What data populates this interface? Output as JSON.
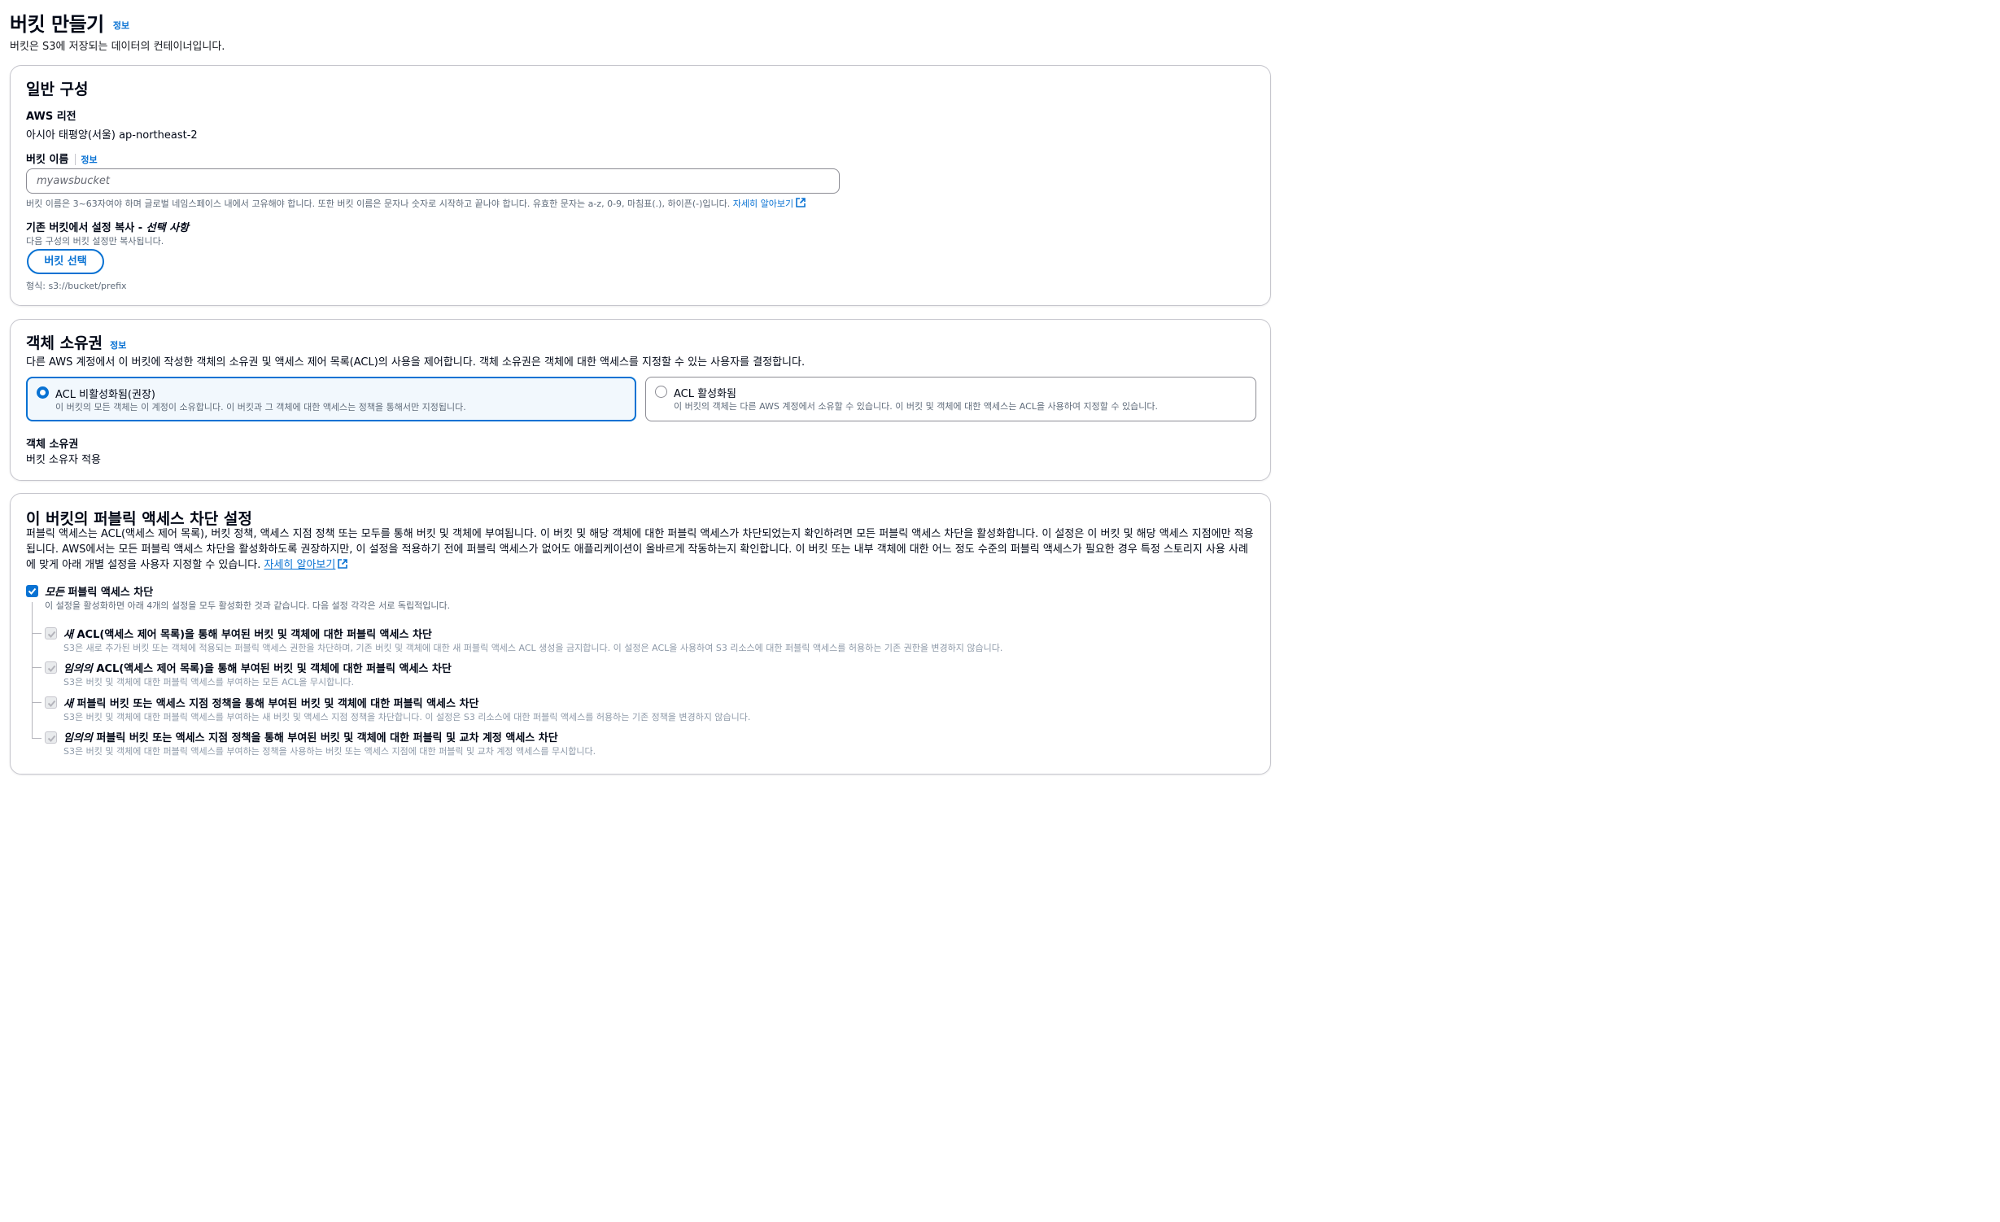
{
  "header": {
    "title": "버킷 만들기",
    "info": "정보",
    "description": "버킷은 S3에 저장되는 데이터의 컨테이너입니다."
  },
  "general": {
    "title": "일반 구성",
    "region_label": "AWS 리전",
    "region_value": "아시아 태평양(서울) ap-northeast-2",
    "bucket_name_label": "버킷 이름",
    "bucket_name_info": "정보",
    "bucket_name_placeholder": "myawsbucket",
    "bucket_name_hint": "버킷 이름은 3~63자여야 하며 글로벌 네임스페이스 내에서 고유해야 합니다. 또한 버킷 이름은 문자나 숫자로 시작하고 끝나야 합니다. 유효한 문자는 a-z, 0-9, 마침표(.), 하이픈(-)입니다.",
    "learn_more": "자세히 알아보기",
    "copy_label": "기존 버킷에서 설정 복사 - ",
    "copy_label_optional": "선택 사항",
    "copy_desc": "다음 구성의 버킷 설정만 복사됩니다.",
    "choose_bucket_button": "버킷 선택",
    "format_hint": "형식: s3://bucket/prefix"
  },
  "ownership": {
    "title": "객체 소유권",
    "info": "정보",
    "description": "다른 AWS 계정에서 이 버킷에 작성한 객체의 소유권 및 액세스 제어 목록(ACL)의 사용을 제어합니다. 객체 소유권은 객체에 대한 액세스를 지정할 수 있는 사용자를 결정합니다.",
    "options": [
      {
        "label": "ACL 비활성화됨(권장)",
        "desc": "이 버킷의 모든 객체는 이 계정이 소유합니다. 이 버킷과 그 객체에 대한 액세스는 정책을 통해서만 지정됩니다.",
        "selected": true
      },
      {
        "label": "ACL 활성화됨",
        "desc": "이 버킷의 객체는 다른 AWS 계정에서 소유할 수 있습니다. 이 버킷 및 객체에 대한 액세스는 ACL을 사용하여 지정할 수 있습니다.",
        "selected": false
      }
    ],
    "owner_label": "객체 소유권",
    "owner_value": "버킷 소유자 적용"
  },
  "public_access": {
    "title": "이 버킷의 퍼블릭 액세스 차단 설정",
    "description": "퍼블릭 액세스는 ACL(액세스 제어 목록), 버킷 정책, 액세스 지점 정책 또는 모두를 통해 버킷 및 객체에 부여됩니다. 이 버킷 및 해당 객체에 대한 퍼블릭 액세스가 차단되었는지 확인하려면 모든 퍼블릭 액세스 차단을 활성화합니다. 이 설정은 이 버킷 및 해당 액세스 지점에만 적용됩니다. AWS에서는 모든 퍼블릭 액세스 차단을 활성화하도록 권장하지만, 이 설정을 적용하기 전에 퍼블릭 액세스가 없어도 애플리케이션이 올바르게 작동하는지 확인합니다. 이 버킷 또는 내부 객체에 대한 어느 정도 수준의 퍼블릭 액세스가 필요한 경우 특정 스토리지 사용 사례에 맞게 아래 개별 설정을 사용자 지정할 수 있습니다.",
    "learn_more": "자세히 알아보기",
    "block_all_em": "모든",
    "block_all_rest": " 퍼블릭 액세스 차단",
    "block_all_desc": "이 설정을 활성화하면 아래 4개의 설정을 모두 활성화한 것과 같습니다. 다음 설정 각각은 서로 독립적입니다.",
    "settings": [
      {
        "em": "새",
        "rest": " ACL(액세스 제어 목록)을 통해 부여된 버킷 및 객체에 대한 퍼블릭 액세스 차단",
        "desc": "S3은 새로 추가된 버킷 또는 객체에 적용되는 퍼블릭 액세스 권한을 차단하며, 기존 버킷 및 객체에 대한 새 퍼블릭 액세스 ACL 생성을 금지합니다. 이 설정은 ACL을 사용하여 S3 리소스에 대한 퍼블릭 액세스를 허용하는 기존 권한을 변경하지 않습니다."
      },
      {
        "em": "임의의",
        "rest": " ACL(액세스 제어 목록)을 통해 부여된 버킷 및 객체에 대한 퍼블릭 액세스 차단",
        "desc": "S3은 버킷 및 객체에 대한 퍼블릭 액세스를 부여하는 모든 ACL을 무시합니다."
      },
      {
        "em": "새",
        "rest": " 퍼블릭 버킷 또는 액세스 지점 정책을 통해 부여된 버킷 및 객체에 대한 퍼블릭 액세스 차단",
        "desc": "S3은 버킷 및 객체에 대한 퍼블릭 액세스를 부여하는 새 버킷 및 액세스 지점 정책을 차단합니다. 이 설정은 S3 리소스에 대한 퍼블릭 액세스를 허용하는 기존 정책을 변경하지 않습니다."
      },
      {
        "em": "임의의",
        "rest": " 퍼블릭 버킷 또는 액세스 지점 정책을 통해 부여된 버킷 및 객체에 대한 퍼블릭 및 교차 계정 액세스 차단",
        "desc": "S3은 버킷 및 객체에 대한 퍼블릭 액세스를 부여하는 정책을 사용하는 버킷 또는 액세스 지점에 대한 퍼블릭 및 교차 계정 액세스를 무시합니다."
      }
    ]
  },
  "colors": {
    "accent": "#0972d3",
    "border": "#c6c6cd",
    "text": "#000716",
    "secondary_text": "#5f6b7a"
  },
  "icons": [
    "external-link-icon",
    "checkmark-icon",
    "radio-selected-icon",
    "radio-unselected-icon"
  ]
}
